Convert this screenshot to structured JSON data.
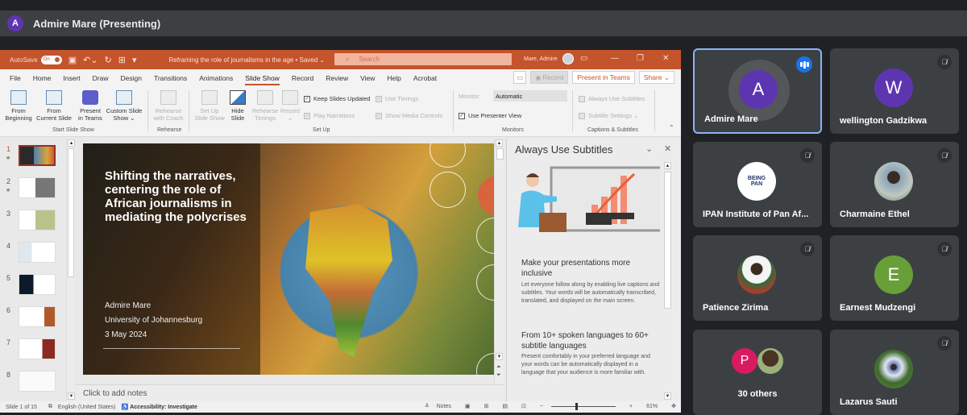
{
  "meet": {
    "presenter_initial": "A",
    "presenter_banner": "Admire Mare (Presenting)",
    "participants": [
      {
        "name": "Admire Mare",
        "initial": "A",
        "color": "#5e35b1",
        "speaking": true
      },
      {
        "name": "wellington Gadzikwa",
        "initial": "W",
        "color": "#5e35b1",
        "muted": true
      },
      {
        "name": "IPAN Institute of Pan Af...",
        "avatar_text_1": "BEING",
        "avatar_text_2": "PAN",
        "muted": true
      },
      {
        "name": "Charmaine Ethel",
        "muted": true
      },
      {
        "name": "Patience Zirima",
        "muted": true
      },
      {
        "name": "Earnest Mudzengi",
        "initial": "E",
        "color": "#689f38",
        "muted": true
      },
      {
        "name": "30 others",
        "initial": "P",
        "color": "#d81b60"
      },
      {
        "name": "Lazarus Sauti",
        "muted": true
      }
    ]
  },
  "ppt": {
    "autosave_label": "AutoSave",
    "autosave_state": "On",
    "doc_title": "Reframing the role of journalisms in the age • Saved ⌄",
    "search_placeholder": "Search",
    "user_name": "Mare, Admire",
    "tabs": [
      "File",
      "Home",
      "Insert",
      "Draw",
      "Design",
      "Transitions",
      "Animations",
      "Slide Show",
      "Record",
      "Review",
      "View",
      "Help",
      "Acrobat"
    ],
    "active_tab": "Slide Show",
    "record_btn": "◉ Record",
    "present_in_teams_btn": "Present in Teams",
    "share_btn": "Share ⌄",
    "ribbon": {
      "from_beginning": [
        "From",
        "Beginning"
      ],
      "from_current": [
        "From",
        "Current Slide"
      ],
      "present_teams": [
        "Present",
        "in Teams"
      ],
      "custom_show": [
        "Custom Slide",
        "Show ⌄"
      ],
      "start_group": "Start Slide Show",
      "rehearse_coach": [
        "Rehearse",
        "with Coach"
      ],
      "rehearse_group": "Rehearse",
      "setup_show": [
        "Set Up",
        "Slide Show"
      ],
      "hide_slide": [
        "Hide",
        "Slide"
      ],
      "rehearse_timings": [
        "Rehearse",
        "Timings"
      ],
      "record": [
        "Record",
        "⌄"
      ],
      "keep_updated": "Keep Slides Updated",
      "use_timings": "Use Timings",
      "play_narrations": "Play Narrations",
      "show_media": "Show Media Controls",
      "setup_group": "Set Up",
      "monitor_label": "Monitor:",
      "monitor_value": "Automatic",
      "presenter_view": "Use Presenter View",
      "monitors_group": "Monitors",
      "always_subtitles": "Always Use Subtitles",
      "subtitle_settings": "Subtitle Settings ⌄",
      "captions_group": "Captions & Subtitles"
    },
    "slide_numbers": [
      "1",
      "2",
      "3",
      "4",
      "5",
      "6",
      "7",
      "8"
    ],
    "slide": {
      "title": "Shifting the narratives, centering the role of African journalisms in mediating the polycrises",
      "author": "Admire Mare",
      "affiliation": "University of Johannesburg",
      "date": "3 May 2024"
    },
    "notes_placeholder": "Click to add notes",
    "pane": {
      "title": "Always Use Subtitles",
      "h1": "Make your presentations more inclusive",
      "p1": "Let everyone follow along by enabling live captions and subtitles. Your words will be automatically transcribed, translated, and displayed on the main screen.",
      "h2": "From 10+ spoken languages to 60+ subtitle languages",
      "p2": "Present comfortably in your preferred language and your words can be automatically displayed in a language that your audience is more familiar with."
    },
    "status": {
      "slide_count": "Slide 1 of 15",
      "language": "English (United States)",
      "accessibility": "Accessibility: Investigate",
      "notes": "Notes",
      "zoom": "61%"
    }
  }
}
